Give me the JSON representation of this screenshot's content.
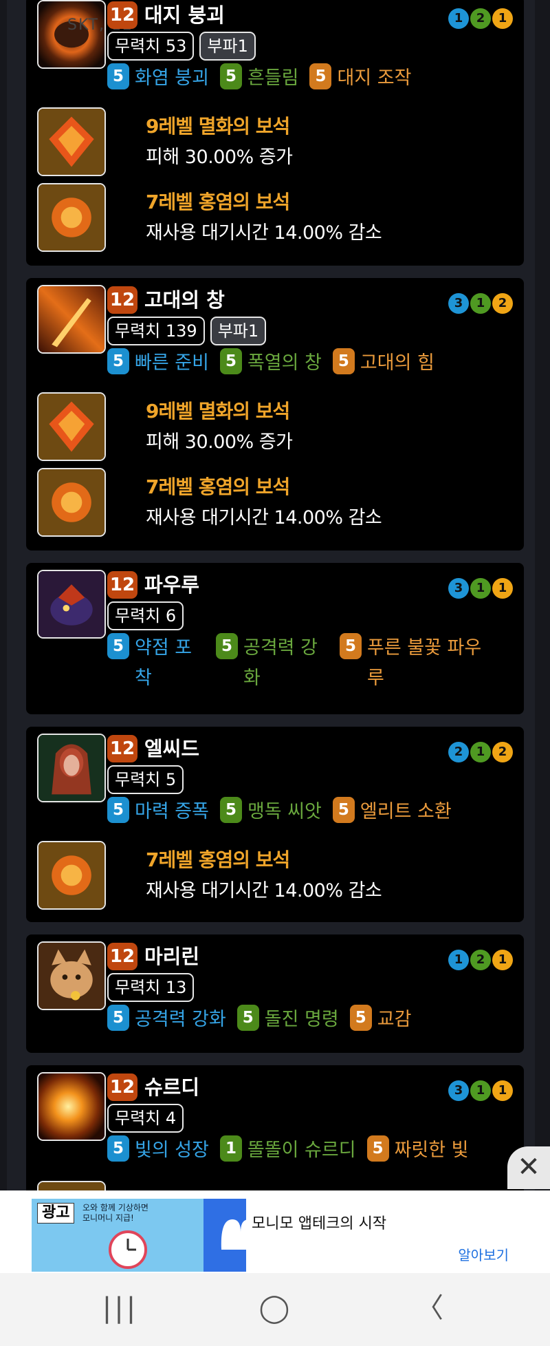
{
  "cards": [
    {
      "level": "12",
      "name": "대지 붕괴",
      "overlay": "SKT, 12",
      "tags": [
        "무력치 53",
        "부파1"
      ],
      "tripods": [
        {
          "num": "5",
          "label": "화염 붕괴",
          "color": "blue"
        },
        {
          "num": "5",
          "label": "흔들림",
          "color": "green"
        },
        {
          "num": "5",
          "label": "대지 조작",
          "color": "orange"
        }
      ],
      "dots": [
        {
          "v": "1",
          "c": "blue"
        },
        {
          "v": "2",
          "c": "green"
        },
        {
          "v": "1",
          "c": "orange"
        }
      ],
      "gems": [
        {
          "title": "9레벨 멸화의 보석",
          "desc": "피해 30.00% 증가"
        },
        {
          "title": "7레벨 홍염의 보석",
          "desc": "재사용 대기시간 14.00% 감소"
        }
      ]
    },
    {
      "level": "12",
      "name": "고대의 창",
      "tags": [
        "무력치 139",
        "부파1"
      ],
      "tripods": [
        {
          "num": "5",
          "label": "빠른 준비",
          "color": "blue"
        },
        {
          "num": "5",
          "label": "폭열의 창",
          "color": "green"
        },
        {
          "num": "5",
          "label": "고대의 힘",
          "color": "orange"
        }
      ],
      "dots": [
        {
          "v": "3",
          "c": "blue"
        },
        {
          "v": "1",
          "c": "green"
        },
        {
          "v": "2",
          "c": "orange"
        }
      ],
      "gems": [
        {
          "title": "9레벨 멸화의 보석",
          "desc": "피해 30.00% 증가"
        },
        {
          "title": "7레벨 홍염의 보석",
          "desc": "재사용 대기시간 14.00% 감소"
        }
      ]
    },
    {
      "level": "12",
      "name": "파우루",
      "tags": [
        "무력치 6"
      ],
      "tripods": [
        {
          "num": "5",
          "label": "약점 포착",
          "color": "blue"
        },
        {
          "num": "5",
          "label": "공격력 강화",
          "color": "green"
        },
        {
          "num": "5",
          "label": "푸른 불꽃 파우루",
          "color": "orange"
        }
      ],
      "dots": [
        {
          "v": "3",
          "c": "blue"
        },
        {
          "v": "1",
          "c": "green"
        },
        {
          "v": "1",
          "c": "orange"
        }
      ],
      "gems": []
    },
    {
      "level": "12",
      "name": "엘씨드",
      "tags": [
        "무력치 5"
      ],
      "tripods": [
        {
          "num": "5",
          "label": "마력 증폭",
          "color": "blue"
        },
        {
          "num": "5",
          "label": "맹독 씨앗",
          "color": "green"
        },
        {
          "num": "5",
          "label": "엘리트 소환",
          "color": "orange"
        }
      ],
      "dots": [
        {
          "v": "2",
          "c": "blue"
        },
        {
          "v": "1",
          "c": "green"
        },
        {
          "v": "2",
          "c": "orange"
        }
      ],
      "gems": [
        {
          "title": "7레벨 홍염의 보석",
          "desc": "재사용 대기시간 14.00% 감소"
        }
      ]
    },
    {
      "level": "12",
      "name": "마리린",
      "tags": [
        "무력치 13"
      ],
      "tripods": [
        {
          "num": "5",
          "label": "공격력 강화",
          "color": "blue"
        },
        {
          "num": "5",
          "label": "돌진 명령",
          "color": "green"
        },
        {
          "num": "5",
          "label": "교감",
          "color": "orange"
        }
      ],
      "dots": [
        {
          "v": "1",
          "c": "blue"
        },
        {
          "v": "2",
          "c": "green"
        },
        {
          "v": "1",
          "c": "orange"
        }
      ],
      "gems": []
    },
    {
      "level": "12",
      "name": "슈르디",
      "tags": [
        "무력치 4"
      ],
      "tripods": [
        {
          "num": "5",
          "label": "빛의 성장",
          "color": "blue"
        },
        {
          "num": "1",
          "label": "똘똘이 슈르디",
          "color": "green"
        },
        {
          "num": "5",
          "label": "짜릿한 빛",
          "color": "orange"
        }
      ],
      "dots": [
        {
          "v": "3",
          "c": "blue"
        },
        {
          "v": "1",
          "c": "green"
        },
        {
          "v": "1",
          "c": "orange"
        }
      ],
      "gems": []
    }
  ],
  "ad": {
    "badge": "광고",
    "snippet": "오와 함께 기상하면\n모니머니 지급!",
    "title": "모니모 앱테크의 시작",
    "cta": "알아보기",
    "close": "✕"
  },
  "nav": {
    "recent": "|||",
    "home": "◯",
    "back": "〈"
  },
  "colors": {
    "blue": "#1e94d6",
    "green": "#4f9a22",
    "orange": "#f0a515",
    "level": "#c0470f",
    "gem_title": "#f0a52a"
  }
}
